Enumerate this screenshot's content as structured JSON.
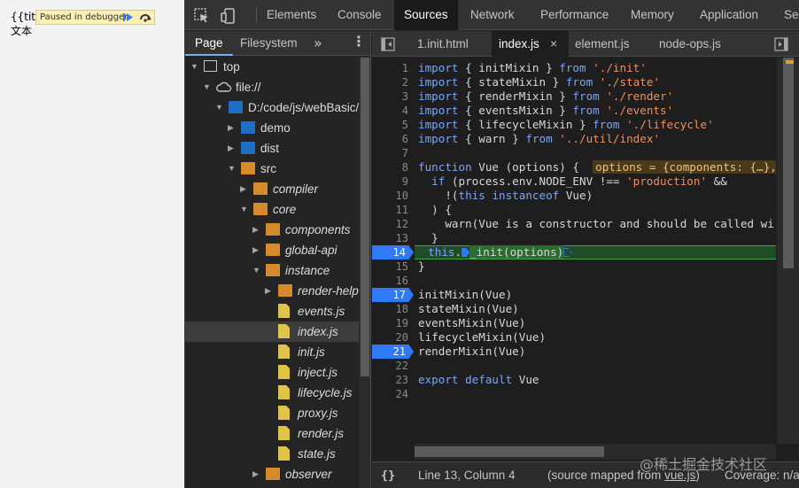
{
  "page": {
    "line1": "{{title",
    "line2": "文本",
    "debugger_pill": "Paused in debugger"
  },
  "devtools": {
    "tabs": [
      "Elements",
      "Console",
      "Sources",
      "Network",
      "Performance",
      "Memory",
      "Application",
      "Se"
    ],
    "active_tab": "Sources",
    "navigator": {
      "tabs": [
        "Page",
        "Filesystem"
      ],
      "active_tab": "Page",
      "more": "»",
      "menu": "⋮",
      "tree": [
        {
          "label": "top",
          "icon": "frame-icon",
          "expanded": true
        },
        {
          "label": "file://",
          "icon": "cloud-icon",
          "expanded": true
        },
        {
          "label": "D:/code/js/webBasic/",
          "icon": "folder-icon",
          "expanded": true
        },
        {
          "label": "demo",
          "icon": "folder-icon",
          "expanded": false
        },
        {
          "label": "dist",
          "icon": "folder-icon",
          "expanded": false
        },
        {
          "label": "src",
          "icon": "folder-icon",
          "expanded": true
        },
        {
          "label": "compiler",
          "icon": "folder-icon",
          "expanded": false
        },
        {
          "label": "core",
          "icon": "folder-icon",
          "expanded": true
        },
        {
          "label": "components",
          "icon": "folder-icon",
          "expanded": false
        },
        {
          "label": "global-api",
          "icon": "folder-icon",
          "expanded": false
        },
        {
          "label": "instance",
          "icon": "folder-icon",
          "expanded": true
        },
        {
          "label": "render-helpers",
          "icon": "folder-icon",
          "expanded": false
        },
        {
          "label": "events.js",
          "icon": "js-file-icon"
        },
        {
          "label": "index.js",
          "icon": "js-file-icon",
          "selected": true
        },
        {
          "label": "init.js",
          "icon": "js-file-icon"
        },
        {
          "label": "inject.js",
          "icon": "js-file-icon"
        },
        {
          "label": "lifecycle.js",
          "icon": "js-file-icon"
        },
        {
          "label": "proxy.js",
          "icon": "js-file-icon"
        },
        {
          "label": "render.js",
          "icon": "js-file-icon"
        },
        {
          "label": "state.js",
          "icon": "js-file-icon"
        },
        {
          "label": "observer",
          "icon": "folder-icon",
          "expanded": false
        }
      ]
    },
    "editor": {
      "tabs": [
        {
          "label": "1.init.html",
          "active": false
        },
        {
          "label": "index.js",
          "active": true,
          "close": "×"
        },
        {
          "label": "element.js",
          "active": false
        },
        {
          "label": "node-ops.js",
          "active": false
        }
      ],
      "lines": [
        {
          "n": "1",
          "t": "import { initMixin } from './init'"
        },
        {
          "n": "2",
          "t": "import { stateMixin } from './state'"
        },
        {
          "n": "3",
          "t": "import { renderMixin } from './render'"
        },
        {
          "n": "4",
          "t": "import { eventsMixin } from './events'"
        },
        {
          "n": "5",
          "t": "import { lifecycleMixin } from './lifecycle'"
        },
        {
          "n": "6",
          "t": "import { warn } from '../util/index'"
        },
        {
          "n": "7",
          "t": ""
        },
        {
          "n": "8",
          "t": "function Vue (options) {",
          "inline": "options = {components: {…},"
        },
        {
          "n": "9",
          "t": "  if (process.env.NODE_ENV !== 'production' &&"
        },
        {
          "n": "10",
          "t": "    !(this instanceof Vue)"
        },
        {
          "n": "11",
          "t": "  ) {"
        },
        {
          "n": "12",
          "t": "    warn('Vue is a constructor and should be called wi"
        },
        {
          "n": "13",
          "t": "  }"
        },
        {
          "n": "14",
          "t": "  this._init(options)",
          "breakpoint": true,
          "execution": true
        },
        {
          "n": "15",
          "t": "}"
        },
        {
          "n": "16",
          "t": ""
        },
        {
          "n": "17",
          "t": "initMixin(Vue)",
          "breakpoint": true
        },
        {
          "n": "18",
          "t": "stateMixin(Vue)"
        },
        {
          "n": "19",
          "t": "eventsMixin(Vue)"
        },
        {
          "n": "20",
          "t": "lifecycleMixin(Vue)"
        },
        {
          "n": "21",
          "t": "renderMixin(Vue)",
          "breakpoint": true
        },
        {
          "n": "22",
          "t": ""
        },
        {
          "n": "23",
          "t": "export default Vue"
        },
        {
          "n": "24",
          "t": ""
        }
      ]
    },
    "status": {
      "braces": "{}",
      "position": "Line 13, Column 4",
      "mapped_prefix": "(source mapped from ",
      "mapped_link": "vue.js",
      "mapped_suffix": ")",
      "coverage": "Coverage: n/a"
    }
  },
  "watermark": "@稀土掘金技术社区",
  "colors": {
    "accent": "#2f7af8",
    "execution": "#1f4d26",
    "keyword": "#7aa6f5",
    "string": "#f18f5e",
    "folder_blue": "#1e6fc4",
    "folder_orange": "#d58a2b",
    "js_file": "#e2c34a"
  }
}
